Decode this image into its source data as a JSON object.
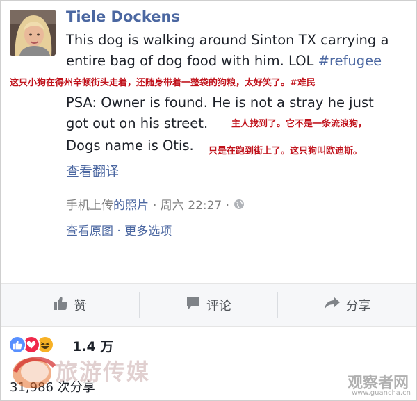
{
  "post": {
    "author": "Tiele Dockens",
    "line1": "This dog is walking around Sinton TX carrying a",
    "line2_text": "entire bag of dog food with him. LOL ",
    "line2_hashtag": "#refugee",
    "psa_line1": "PSA: Owner is found. He is not a stray he just",
    "psa_line2": "got out on his street.",
    "psa_line3": "Dogs name is Otis.",
    "see_translation": "查看翻译",
    "meta_prefix": "手机上传",
    "meta_link": "的照片",
    "meta_time": "· 周六 22:27 ·",
    "options": "查看原图 · 更多选项"
  },
  "annotations": {
    "note1": "这只小狗在得州辛顿街头走着，还随身带着一整袋的狗粮，太好笑了。#难民",
    "note2": "主人找到了。它不是一条流浪狗，",
    "note3": "只是在跑到街上了。这只狗叫欧迪斯。"
  },
  "actions": {
    "like": "赞",
    "comment": "评论",
    "share": "分享"
  },
  "stats": {
    "reactions": "1.4 万",
    "shares": "31,986 次分享"
  },
  "icons": {
    "like": "thumbs-up-icon",
    "comment": "comment-bubble-icon",
    "share": "share-arrow-icon",
    "globe": "globe-icon",
    "reaction_like": "like-reaction-icon",
    "reaction_love": "love-reaction-icon",
    "reaction_haha": "haha-reaction-icon"
  },
  "colors": {
    "link": "#4b67a1",
    "annotation": "#c0121b",
    "action_bar": "#f6f7f9"
  },
  "watermark": {
    "left_text": "旅游传媒",
    "site": "观察者网",
    "url": "www.guancha.cn"
  }
}
